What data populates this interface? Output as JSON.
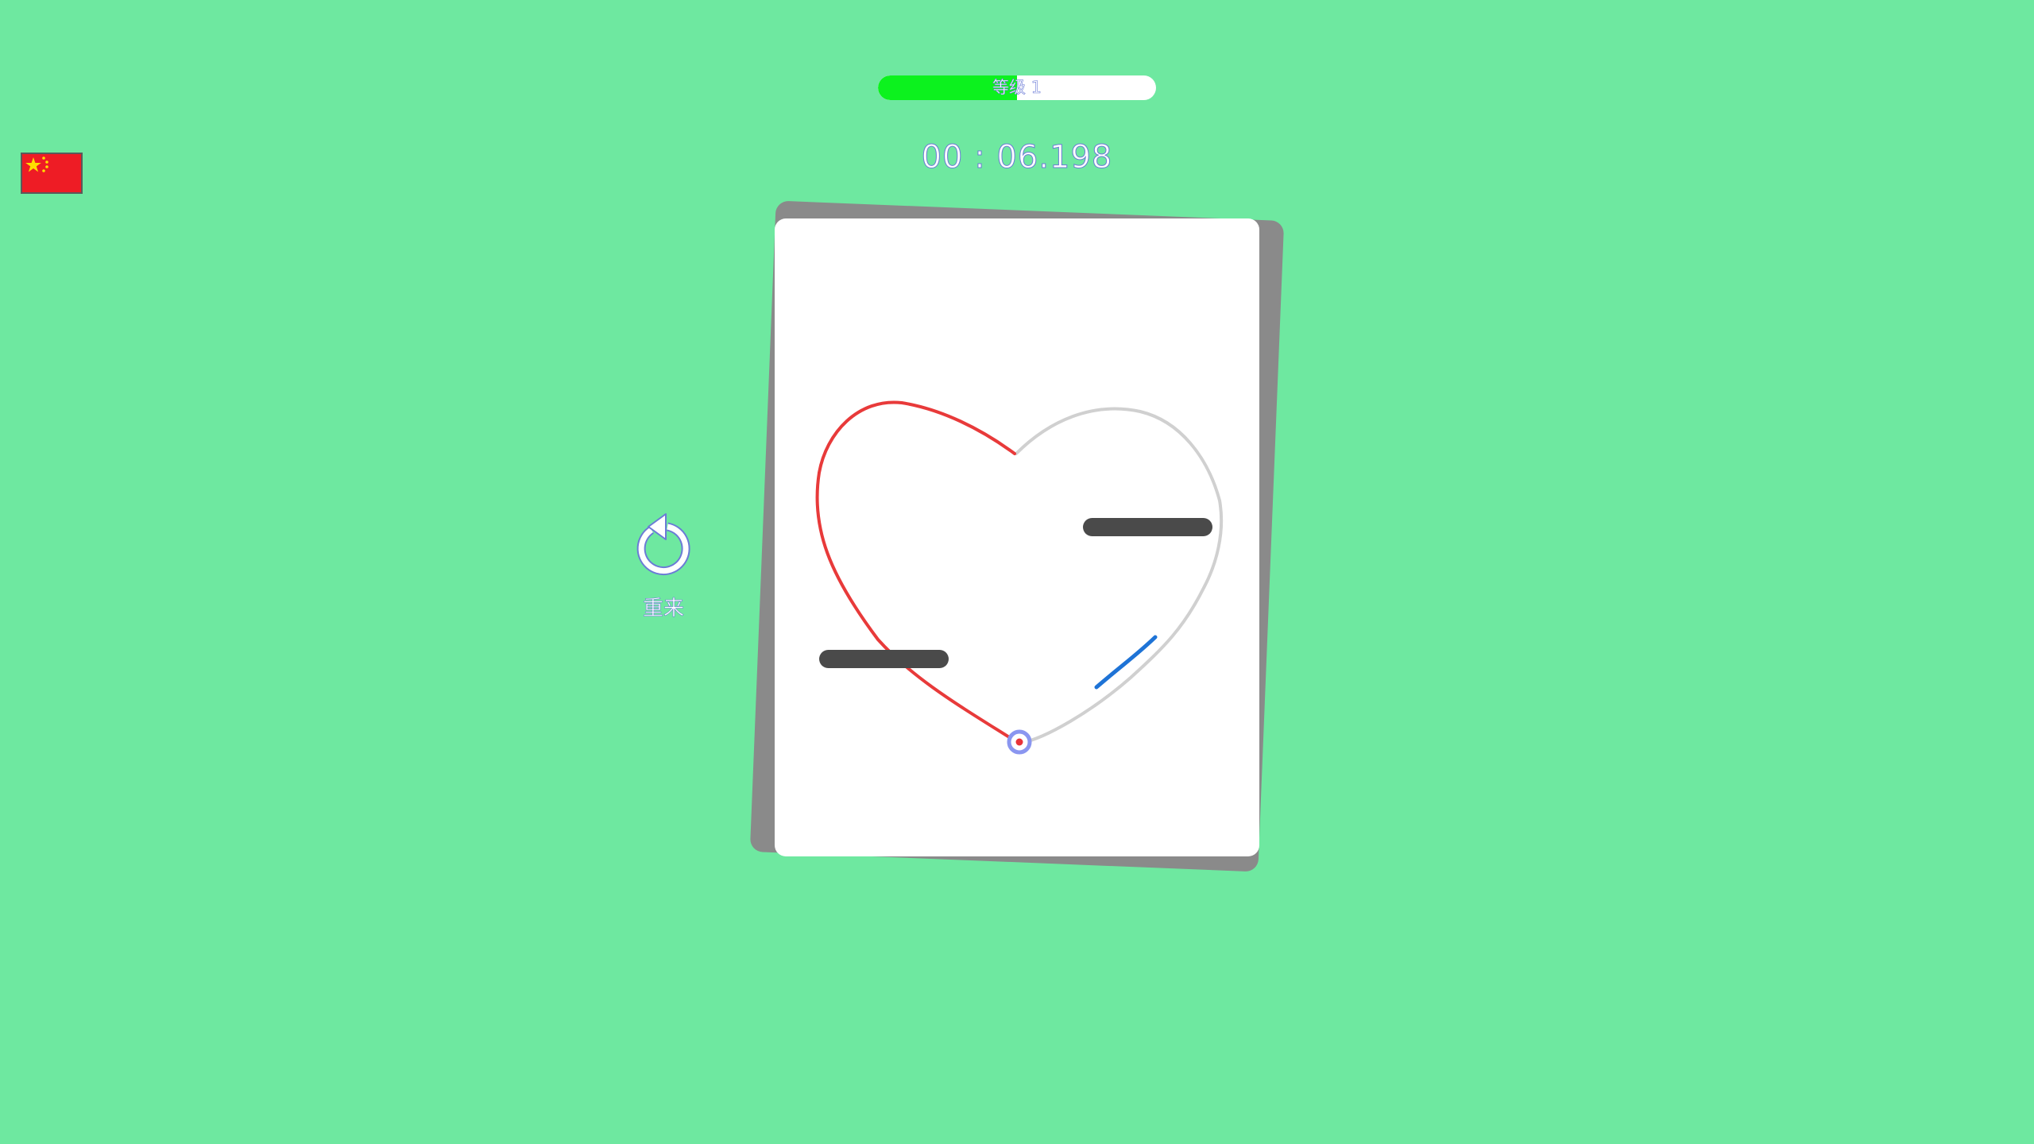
{
  "language": {
    "flag": "china-flag-icon",
    "colors": {
      "field": "#ee1c25",
      "star": "#ffde00"
    }
  },
  "level": {
    "label": "等级 1",
    "progress": 0.5,
    "fill_color": "#0cf21e"
  },
  "timer": {
    "value": "00 : 06.198"
  },
  "restart": {
    "icon": "restart-icon",
    "label": "重来"
  },
  "puzzle": {
    "shape": "heart",
    "colors": {
      "drawn_path": "#e83a3a",
      "guide_path": "#d0d0d0",
      "hint_path": "#1e73d6",
      "obstacle": "#4a4a4a",
      "pen": "#8a96f0",
      "pen_center": "#e8333a"
    },
    "obstacles": [
      "left-bar",
      "right-bar"
    ]
  }
}
